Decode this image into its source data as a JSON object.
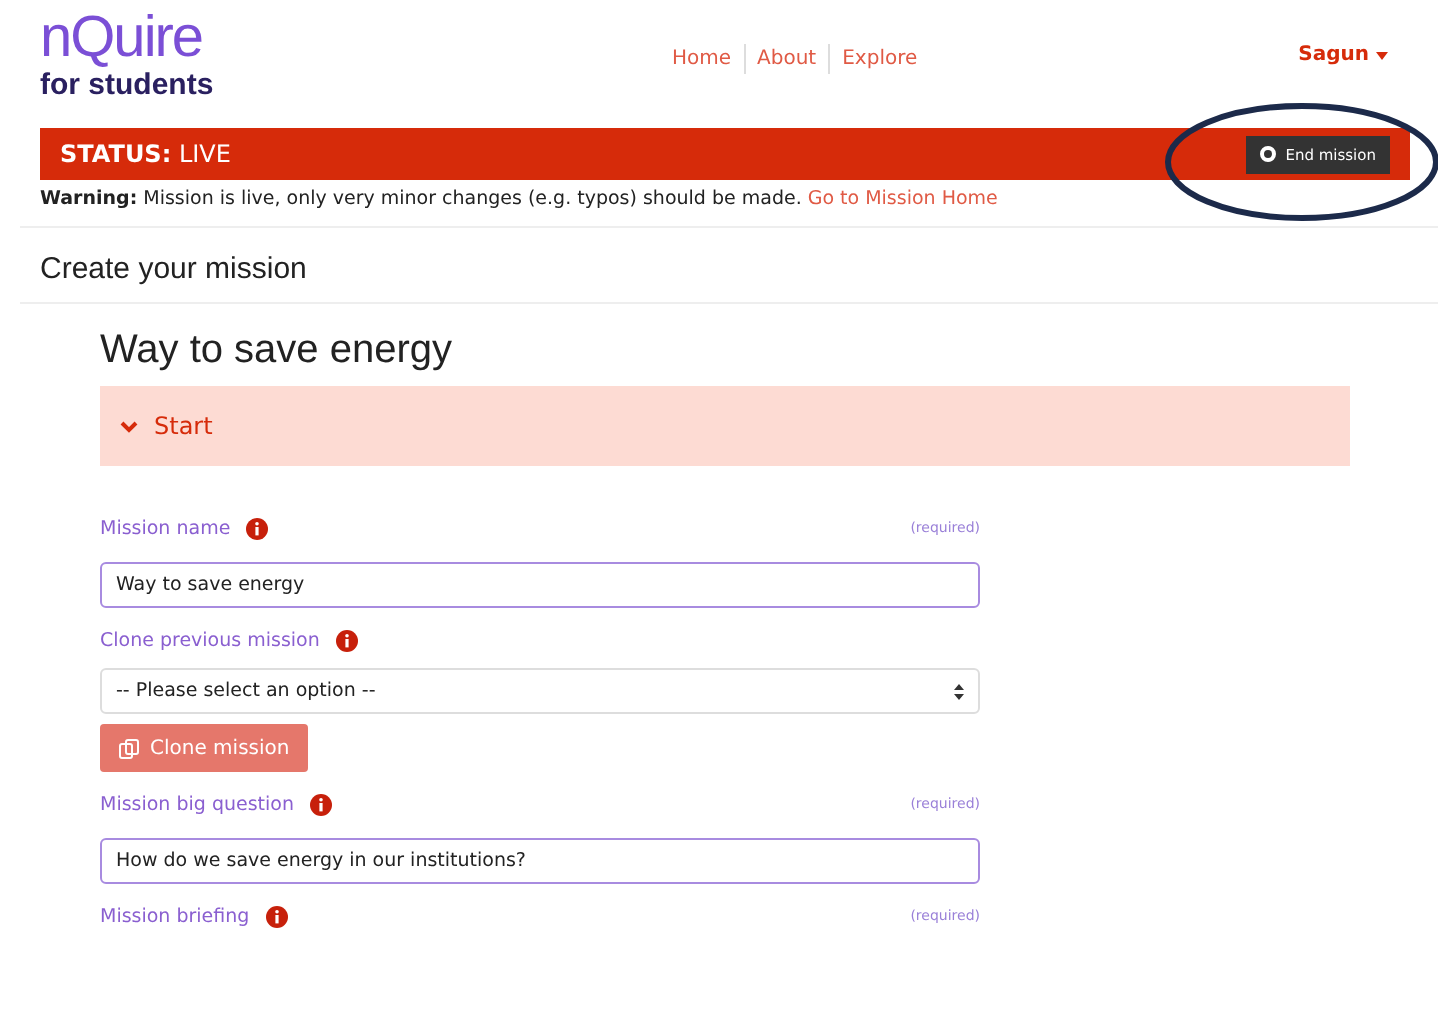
{
  "logo": {
    "name": "nQuire",
    "tagline": "for students"
  },
  "nav": [
    "Home",
    "About",
    "Explore"
  ],
  "user": {
    "name": "Sagun"
  },
  "status": {
    "label": "STATUS:",
    "value": "LIVE",
    "button": "End mission"
  },
  "warning": {
    "text": "**Warning:** Mission is live, only very minor changes (e.g. typos) should be made.",
    "link": "Go to Mission Home"
  },
  "page_title": "Create your mission",
  "mission_title": "Way to save energy",
  "section": {
    "label": "Start",
    "expanded": true
  },
  "fields": [
    {
      "kind": "text",
      "label": "Mission name",
      "required": "(required)",
      "value": "Way to save energy"
    },
    {
      "kind": "select",
      "label": "Clone previous mission",
      "value": "-- Please select an option --",
      "button": "Clone mission"
    },
    {
      "kind": "text",
      "label": "Mission big question",
      "required": "(required)",
      "value": "How do we save energy in our institutions?"
    },
    {
      "kind": "label",
      "label": "Mission briefing",
      "required": "(required)"
    }
  ]
}
